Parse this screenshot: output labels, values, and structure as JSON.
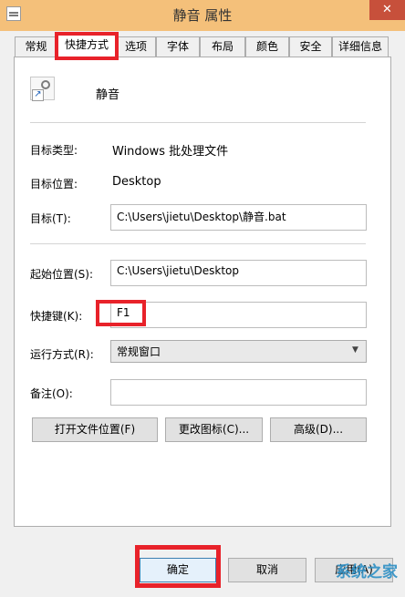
{
  "window": {
    "title": "静音 属性",
    "close_glyph": "✕"
  },
  "tabs": [
    {
      "label": "常规",
      "active": false
    },
    {
      "label": "快捷方式",
      "active": true
    },
    {
      "label": "选项",
      "active": false
    },
    {
      "label": "字体",
      "active": false
    },
    {
      "label": "布局",
      "active": false
    },
    {
      "label": "颜色",
      "active": false
    },
    {
      "label": "安全",
      "active": false
    },
    {
      "label": "详细信息",
      "active": false
    }
  ],
  "shortcut": {
    "name": "静音",
    "target_type_label": "目标类型:",
    "target_type_value": "Windows 批处理文件",
    "target_location_label": "目标位置:",
    "target_location_value": "Desktop",
    "target_label": "目标(T):",
    "target_value": "C:\\Users\\jietu\\Desktop\\静音.bat",
    "start_in_label": "起始位置(S):",
    "start_in_value": "C:\\Users\\jietu\\Desktop",
    "hotkey_label": "快捷键(K):",
    "hotkey_value": "F1",
    "run_label": "运行方式(R):",
    "run_value": "常规窗口",
    "comment_label": "备注(O):",
    "comment_value": ""
  },
  "buttons": {
    "open_location": "打开文件位置(F)",
    "change_icon": "更改图标(C)...",
    "advanced": "高级(D)...",
    "ok": "确定",
    "cancel": "取消",
    "apply": "应用(A)"
  },
  "watermark": {
    "text": "系统之家"
  },
  "colors": {
    "highlight": "#e8222a",
    "titlebar": "#f4c07a",
    "close": "#c7503b"
  }
}
